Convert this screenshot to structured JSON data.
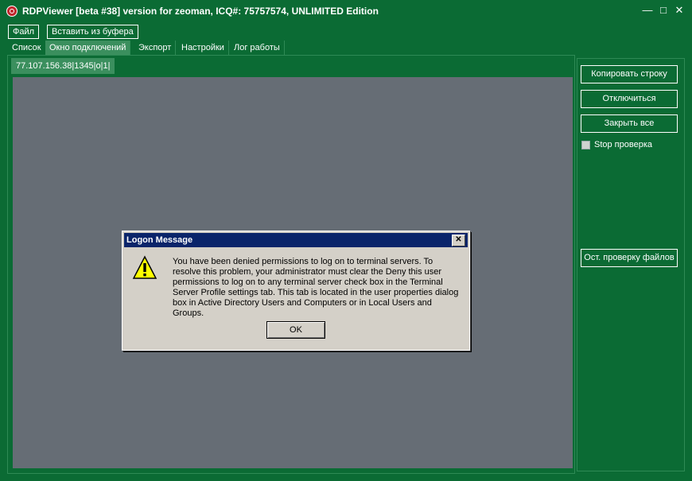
{
  "window": {
    "title": "RDPViewer [beta #38] version for zeoman, ICQ#: 75757574, UNLIMITED Edition",
    "minimize": "—",
    "maximize": "□",
    "close": "✕"
  },
  "menu": {
    "file": "Файл",
    "paste": "Вставить из буфера"
  },
  "tabs": [
    "Список",
    "Окно подключений",
    "Экспорт",
    "Настройки",
    "Лог работы"
  ],
  "active_tab": "Окно подключений",
  "connection_tab": "77.107.156.38|1345|o|1|",
  "right_panel": {
    "copy_row": "Копировать строку",
    "disconnect": "Отключиться",
    "close_all": "Закрыть все",
    "stop_check_label": "Stop проверка",
    "stop_files_check": "Ост. проверку файлов"
  },
  "dialog": {
    "title": "Logon Message",
    "message": "You have been denied permissions to log on to terminal servers. To resolve this problem, your administrator must clear the Deny this user permissions to log on to any terminal server check box in the Terminal Server Profile settings tab. This tab is located in the user properties dialog box in Active Directory Users and Computers or in Local Users and Groups.",
    "ok": "OK",
    "close": "✕"
  },
  "colors": {
    "window_bg": "#0b6b34",
    "remote_screen": "#666d75",
    "dialog_title": "#0a246a",
    "dialog_bg": "#d4d0c8"
  },
  "icons": {
    "app": "rdpviewer-app-icon",
    "warning": "warning-icon"
  }
}
